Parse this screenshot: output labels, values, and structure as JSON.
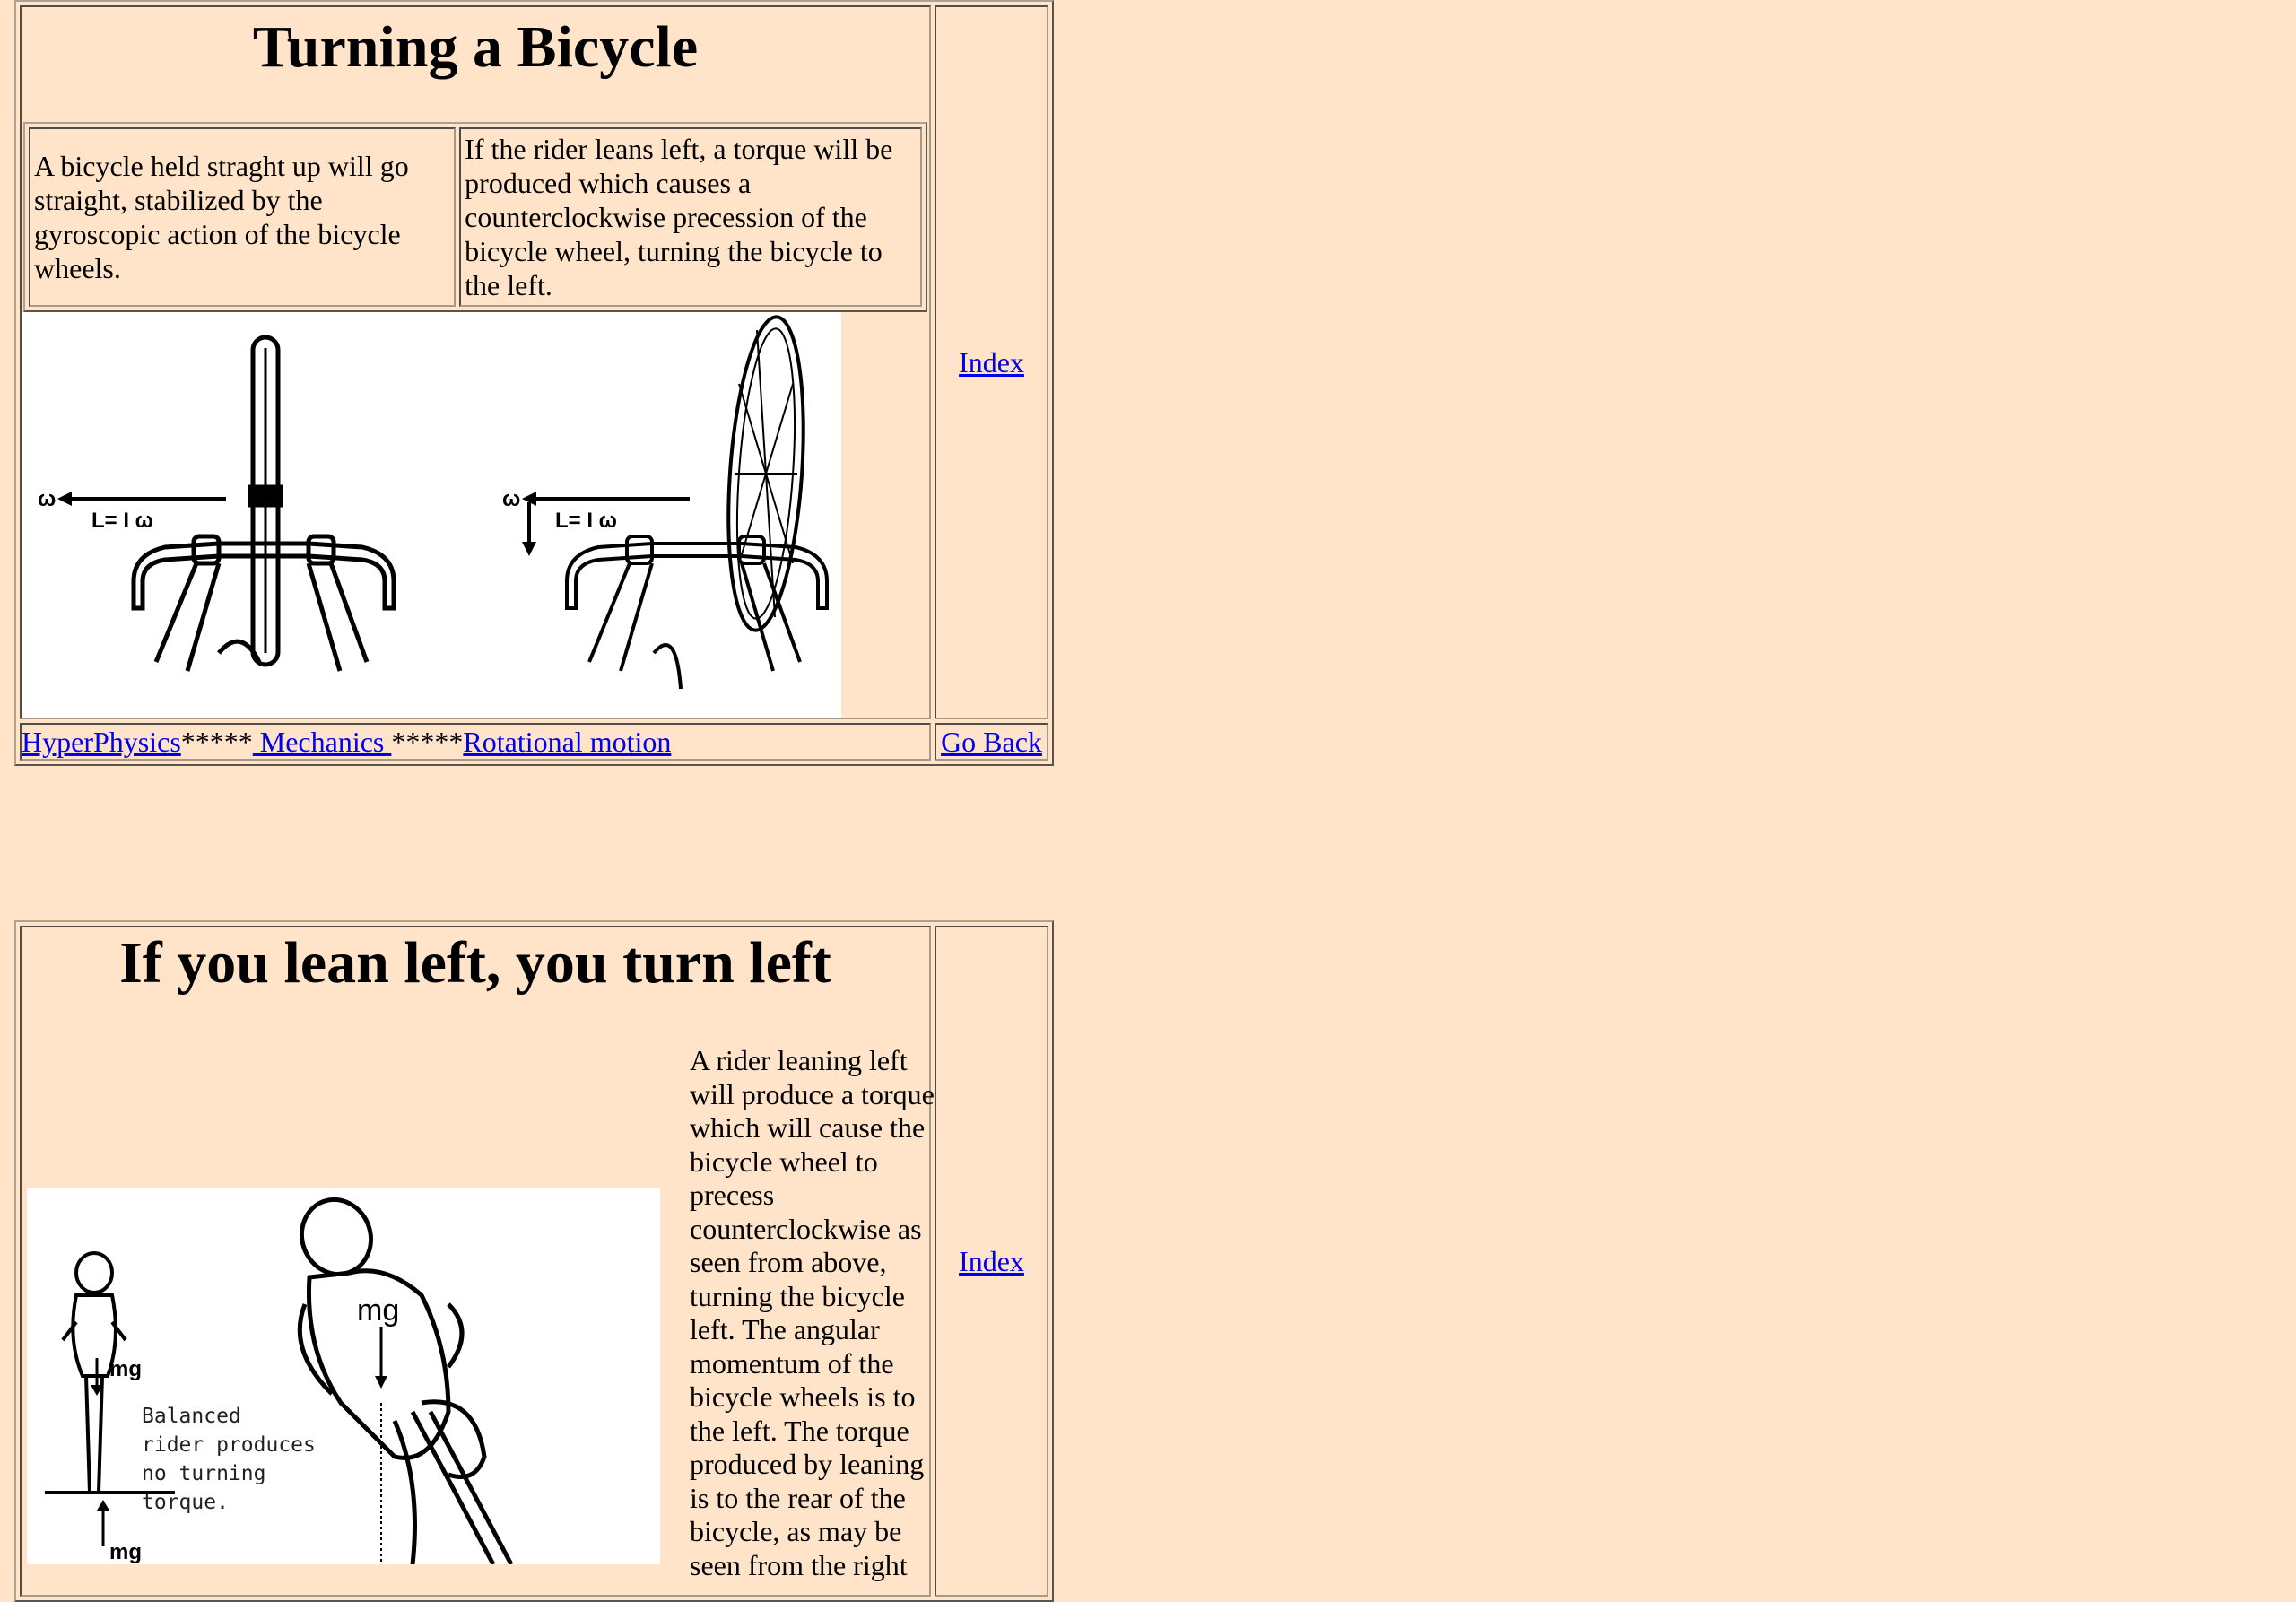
{
  "section1": {
    "title": "Turning a Bicycle",
    "left_text": "A bicycle held straght up will go straight, stabilized by the gyroscopic action of the bicycle wheels.",
    "right_text": "If the rider leans left, a torque will be produced which causes a counterclockwise precession of the bicycle wheel, turning the bicycle to the left.",
    "figure": {
      "omega_label": "ω",
      "momentum_label": "L= I ω"
    },
    "index_link": "Index",
    "nav": {
      "link1": " HyperPhysics",
      "sep1": "*****",
      "link2": " Mechanics ",
      "sep2": "*****",
      "link3": "Rotational motion",
      "back": "Go Back"
    }
  },
  "section2": {
    "title": "If you lean left, you turn left",
    "paragraph": "A rider leaning left will produce a torque which will cause the bicycle wheel to precess counterclockwise as seen from above, turning the bicycle left. The angular momentum of the bicycle wheels is to the left. The torque produced by leaning is to the rear of the bicycle, as may be seen from the right",
    "figure": {
      "mg_small": "mg",
      "mg_large": "mg",
      "mg_bottom": "mg",
      "balanced_l1": "Balanced",
      "balanced_l2": "rider produces",
      "balanced_l3": "no turning",
      "balanced_l4": "torque."
    },
    "index_link": "Index"
  }
}
